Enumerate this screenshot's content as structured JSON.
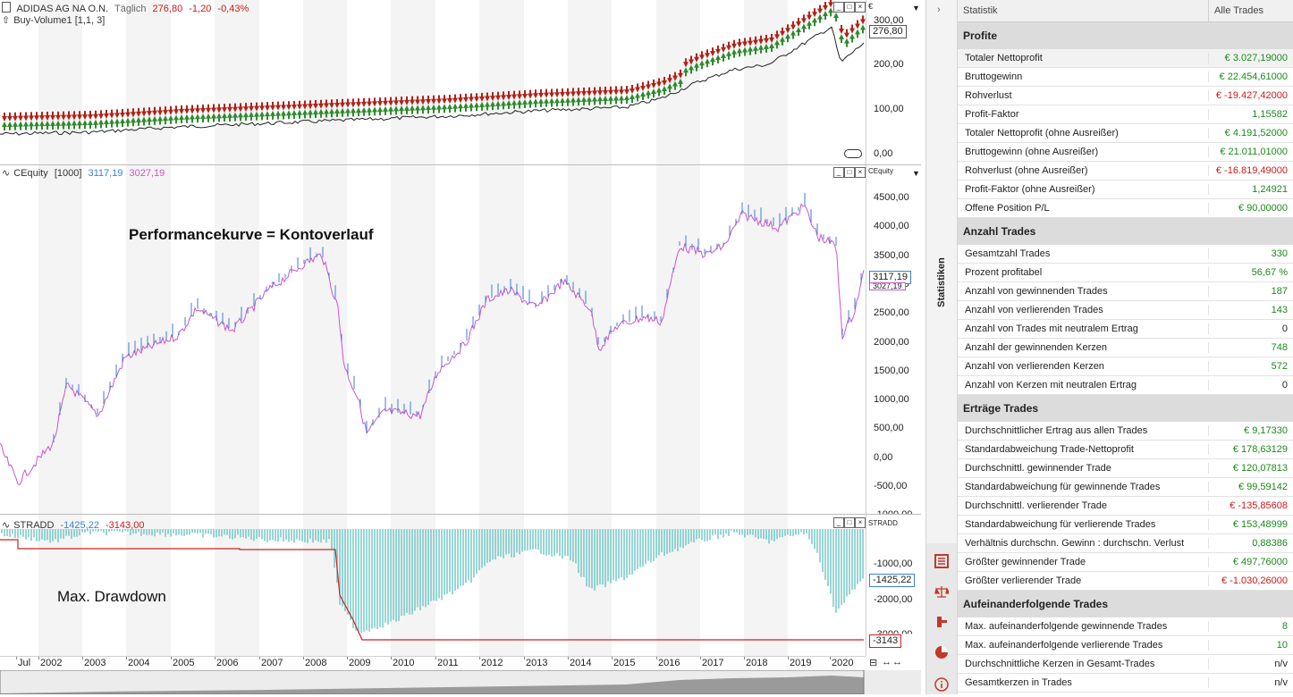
{
  "chart": {
    "price_pane": {
      "symbol": "ADIDAS AG NA O.N.",
      "interval": "Täglich",
      "last": "276,80",
      "change": "-1,20",
      "change_pct": "-0,43%",
      "indicator": "Buy-Volume1  [1,1, 3]",
      "currency": "€",
      "ticks": [
        "300,00",
        "200,00",
        "100,00",
        "0,00"
      ],
      "price_tag": "276,80"
    },
    "equity_pane": {
      "title": "CEquity",
      "params": "[1000]",
      "value1": "3117,19",
      "value2": "3027,19",
      "axis_title": "CEquity",
      "annotation": "Performancekurve = Kontoverlauf",
      "ticks": [
        "4500,00",
        "4000,00",
        "3500,00",
        "3000,00",
        "2500,00",
        "2000,00",
        "1500,00",
        "1000,00",
        "500,00",
        "0,00",
        "-500,00",
        "-1000,00"
      ],
      "tag1": "3117,19",
      "tag2": "3027,19"
    },
    "dd_pane": {
      "title": "STRADD",
      "value1": "-1425,22",
      "value2": "-3143,00",
      "axis_title": "STRADD",
      "annotation": "Max. Drawdown",
      "ticks": [
        "-1000,00",
        "-2000,00",
        "-3000,00"
      ],
      "tag1": "-1425,22",
      "tag2": "-3143"
    },
    "x_labels": [
      "Jul",
      "2002",
      "2003",
      "2004",
      "2005",
      "2006",
      "2007",
      "2008",
      "2009",
      "2010",
      "2011",
      "2012",
      "2013",
      "2014",
      "2015",
      "2016",
      "2017",
      "2018",
      "2019",
      "2020"
    ],
    "colors": {
      "equity_line": "#cc55cc",
      "equity_up": "#3a7fd8",
      "dd_bars": "#6cc3c3",
      "dd_line": "#cc2222",
      "bull": "#2e8b2e",
      "bear": "#b0231a"
    }
  },
  "side_tab": {
    "label": "Statistiken"
  },
  "stats": {
    "col_stat": "Statistik",
    "col_all": "Alle Trades",
    "sections": [
      {
        "title": "Profite",
        "rows": [
          {
            "label": "Totaler Nettoprofit",
            "value": "€ 3.027,19000",
            "tone": "pos",
            "hl": true
          },
          {
            "label": "Bruttogewinn",
            "value": "€ 22.454,61000",
            "tone": "pos"
          },
          {
            "label": "Rohverlust",
            "value": "€ -19.427,42000",
            "tone": "neg"
          },
          {
            "label": "Profit-Faktor",
            "value": "1,15582",
            "tone": "pos"
          },
          {
            "label": "Totaler Nettoprofit (ohne Ausreißer)",
            "value": "€ 4.191,52000",
            "tone": "pos"
          },
          {
            "label": "Bruttogewinn (ohne Ausreißer)",
            "value": "€ 21.011,01000",
            "tone": "pos"
          },
          {
            "label": "Rohverlust (ohne Ausreißer)",
            "value": "€ -16.819,49000",
            "tone": "neg"
          },
          {
            "label": "Profit-Faktor (ohne Ausreißer)",
            "value": "1,24921",
            "tone": "pos"
          },
          {
            "label": "Offene Position P/L",
            "value": "€ 90,00000",
            "tone": "pos"
          }
        ]
      },
      {
        "title": "Anzahl Trades",
        "rows": [
          {
            "label": "Gesamtzahl Trades",
            "value": "330",
            "tone": "pos"
          },
          {
            "label": "Prozent profitabel",
            "value": "56,67 %",
            "tone": "pos"
          },
          {
            "label": "Anzahl von gewinnenden Trades",
            "value": "187",
            "tone": "pos"
          },
          {
            "label": "Anzahl von verlierenden Trades",
            "value": "143",
            "tone": "pos"
          },
          {
            "label": "Anzahl von Trades mit neutralem Ertrag",
            "value": "0",
            "tone": "neu"
          },
          {
            "label": "Anzahl der gewinnenden Kerzen",
            "value": "748",
            "tone": "pos"
          },
          {
            "label": "Anzahl von verlierenden Kerzen",
            "value": "572",
            "tone": "pos"
          },
          {
            "label": "Anzahl von Kerzen mit neutralen Ertrag",
            "value": "0",
            "tone": "neu"
          }
        ]
      },
      {
        "title": "Erträge Trades",
        "rows": [
          {
            "label": "Durchschnittlicher Ertrag aus allen Trades",
            "value": "€ 9,17330",
            "tone": "pos"
          },
          {
            "label": "Standardabweichung Trade-Nettoprofit",
            "value": "€ 178,63129",
            "tone": "pos"
          },
          {
            "label": "Durchschnittl. gewinnender Trade",
            "value": "€ 120,07813",
            "tone": "pos"
          },
          {
            "label": "Standardabweichung für gewinnende Trades",
            "value": "€ 99,59142",
            "tone": "pos"
          },
          {
            "label": "Durchschnittl. verlierender Trade",
            "value": "€ -135,85608",
            "tone": "neg"
          },
          {
            "label": "Standardabweichung für verlierende Trades",
            "value": "€ 153,48999",
            "tone": "pos"
          },
          {
            "label": "Verhältnis durchschn. Gewinn : durchschn. Verlust",
            "value": "0,88386",
            "tone": "pos"
          },
          {
            "label": "Größter gewinnender Trade",
            "value": "€ 497,76000",
            "tone": "pos"
          },
          {
            "label": "Größter verlierender Trade",
            "value": "€ -1.030,26000",
            "tone": "neg"
          }
        ]
      },
      {
        "title": "Aufeinanderfolgende Trades",
        "rows": [
          {
            "label": "Max. aufeinanderfolgende gewinnende Trades",
            "value": "8",
            "tone": "pos"
          },
          {
            "label": "Max. aufeinanderfolgende verlierende Trades",
            "value": "10",
            "tone": "pos"
          },
          {
            "label": "Durchschnittliche Kerzen in Gesamt-Trades",
            "value": "n/v",
            "tone": "neu"
          },
          {
            "label": "Gesamtkerzen in Trades",
            "value": "n/v",
            "tone": "neu"
          }
        ]
      }
    ]
  }
}
